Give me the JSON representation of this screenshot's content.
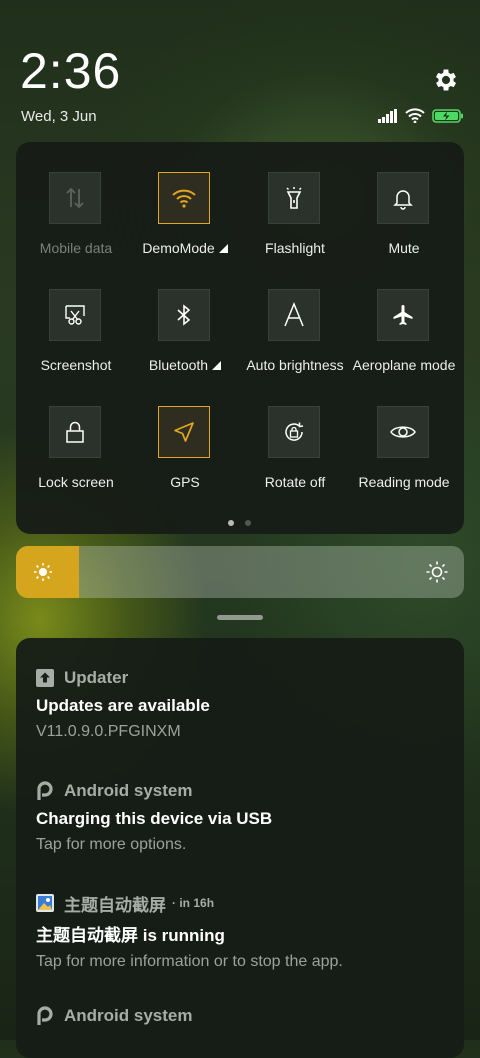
{
  "status": {
    "time": "2:36",
    "date": "Wed, 3 Jun",
    "icons": [
      "signal-icon",
      "wifi-icon",
      "battery-charging-icon"
    ]
  },
  "quick_settings": {
    "tiles": [
      {
        "label": "Mobile data",
        "icon": "mobile-data-icon",
        "active": false,
        "disabled": true
      },
      {
        "label": "DemoMode",
        "icon": "wifi-icon",
        "active": true,
        "expandable": true
      },
      {
        "label": "Flashlight",
        "icon": "flashlight-icon",
        "active": false
      },
      {
        "label": "Mute",
        "icon": "bell-icon",
        "active": false
      },
      {
        "label": "Screenshot",
        "icon": "screenshot-icon",
        "active": false
      },
      {
        "label": "Bluetooth",
        "icon": "bluetooth-icon",
        "active": false,
        "expandable": true
      },
      {
        "label": "Auto brightness",
        "icon": "auto-brightness-icon",
        "active": false
      },
      {
        "label": "Aeroplane mode",
        "icon": "airplane-icon",
        "active": false
      },
      {
        "label": "Lock screen",
        "icon": "lock-icon",
        "active": false
      },
      {
        "label": "GPS",
        "icon": "location-arrow-icon",
        "active": true
      },
      {
        "label": "Rotate off",
        "icon": "rotate-lock-icon",
        "active": false
      },
      {
        "label": "Reading mode",
        "icon": "eye-icon",
        "active": false
      }
    ],
    "page_index": 0,
    "page_count": 2
  },
  "brightness": {
    "level": 0.14,
    "accent": "#d6a51e"
  },
  "notifications": [
    {
      "app": "Updater",
      "time": "",
      "title": "Updates are available",
      "body": "V11.0.9.0.PFGINXM",
      "icon": "updater-icon"
    },
    {
      "app": "Android system",
      "time": "",
      "title": "Charging this device via USB",
      "body": "Tap for more options.",
      "icon": "android-system-icon"
    },
    {
      "app": "主题自动截屏",
      "time": "in 16h",
      "title": "主题自动截屏 is running",
      "body": "Tap for more information or to stop the app.",
      "icon": "theme-app-icon"
    },
    {
      "app": "Android system",
      "time": "",
      "title": "",
      "body": "",
      "icon": "android-system-icon"
    }
  ],
  "colors": {
    "accent": "#e0a820",
    "panel": "#161c16"
  }
}
